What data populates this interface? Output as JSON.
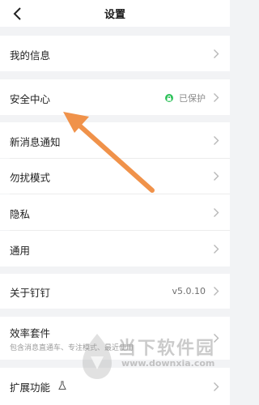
{
  "header": {
    "title": "设置"
  },
  "rows": {
    "my_info": "我的信息",
    "security": "安全中心",
    "security_status": "已保护",
    "notifications": "新消息通知",
    "dnd": "勿扰模式",
    "privacy": "隐私",
    "general": "通用",
    "about": "关于钉钉",
    "version": "v5.0.10",
    "efficiency": "效率套件",
    "efficiency_sub": "包含消息直通车、专注模式、最近使用",
    "extensions": "扩展功能"
  },
  "watermark": {
    "name": "当下软件园",
    "url": "www.downxia.com"
  },
  "colors": {
    "arrow": "#f0924a",
    "secure_green": "#2fc25b",
    "background": "#f2f3f5"
  },
  "icons": {
    "back": "chevron-left-icon",
    "chevron": "chevron-right-icon",
    "lock": "lock-icon",
    "flask": "flask-icon"
  }
}
